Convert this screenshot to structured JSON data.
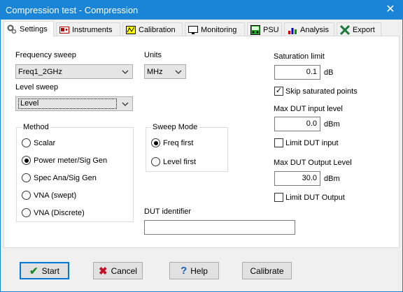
{
  "window": {
    "title": "Compression test - Compression",
    "close_glyph": "✕"
  },
  "tabs": [
    {
      "label": "Settings",
      "icon": "gears-icon",
      "active": true
    },
    {
      "label": "Instruments",
      "icon": "instrument-icon"
    },
    {
      "label": "Calibration",
      "icon": "calibration-icon"
    },
    {
      "label": "Monitoring",
      "icon": "monitor-icon"
    },
    {
      "label": "PSU",
      "icon": "psu-icon"
    },
    {
      "label": "Analysis",
      "icon": "analysis-icon"
    },
    {
      "label": "Export",
      "icon": "export-icon"
    }
  ],
  "settings": {
    "freq_sweep_label": "Frequency sweep",
    "freq_sweep_value": "Freq1_2GHz",
    "units_label": "Units",
    "units_value": "MHz",
    "level_sweep_label": "Level sweep",
    "level_sweep_value": "Level",
    "method": {
      "label": "Method",
      "options": [
        "Scalar",
        "Power meter/Sig Gen",
        "Spec Ana/Sig Gen",
        "VNA (swept)",
        "VNA (Discrete)"
      ],
      "selected": "Power meter/Sig Gen"
    },
    "sweep_mode": {
      "label": "Sweep Mode",
      "options": [
        "Freq first",
        "Level first"
      ],
      "selected": "Freq first"
    },
    "dut_identifier_label": "DUT identifier",
    "dut_identifier_value": "",
    "saturation_limit_label": "Saturation limit",
    "saturation_limit_value": "0.1",
    "saturation_limit_unit": "dB",
    "skip_saturated_label": "Skip saturated points",
    "skip_saturated_checked": true,
    "max_dut_input_label": "Max DUT input level",
    "max_dut_input_value": "0.0",
    "max_dut_input_unit": "dBm",
    "limit_dut_input_label": "Limit DUT input",
    "limit_dut_input_checked": false,
    "max_dut_output_label": "Max DUT Output Level",
    "max_dut_output_value": "30.0",
    "max_dut_output_unit": "dBm",
    "limit_dut_output_label": "Limit DUT Output",
    "limit_dut_output_checked": false
  },
  "buttons": {
    "start": "Start",
    "cancel": "Cancel",
    "help": "Help",
    "calibrate": "Calibrate"
  },
  "colors": {
    "titlebar": "#1a84d6",
    "default_border": "#0078d7",
    "check_green": "#1b8a2a",
    "cancel_red": "#c0102a",
    "help_blue": "#1c5fb0"
  }
}
